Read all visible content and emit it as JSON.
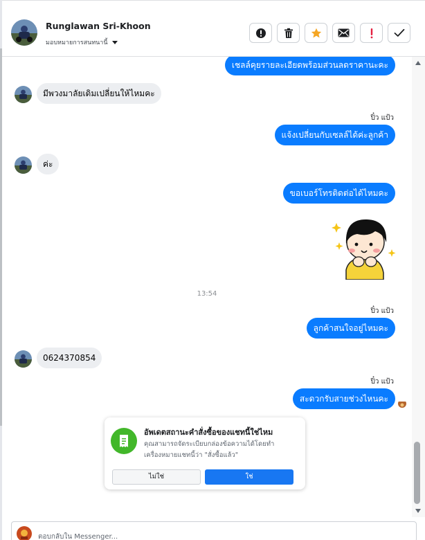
{
  "header": {
    "contact_name": "Runglawan Sri-Khoon",
    "assign_label": "มอบหมายการสนทนานี้",
    "actions": [
      {
        "name": "mark-spam-button",
        "icon": "alert-circle-icon"
      },
      {
        "name": "delete-button",
        "icon": "trash-icon"
      },
      {
        "name": "star-button",
        "icon": "star-icon"
      },
      {
        "name": "mark-unread-button",
        "icon": "envelope-icon"
      },
      {
        "name": "follow-up-button",
        "icon": "exclamation-icon"
      },
      {
        "name": "mark-done-button",
        "icon": "checkmark-icon"
      }
    ]
  },
  "thread": {
    "messages": [
      {
        "direction": "outgoing",
        "text": "เชลล์คุยรายละเอียดพร้อมส่วนลดราคานะคะ"
      },
      {
        "direction": "incoming",
        "text": "มีพวงมาลัยเดิมเปลี่ยนให้ไหมคะ"
      },
      {
        "direction": "outgoing",
        "sender": "ปิ๋ว แป้ว",
        "text": "แจ้งเปลี่ยนกับเซลล์ได้ค่ะลูกค้า"
      },
      {
        "direction": "incoming",
        "text": "ค่ะ"
      },
      {
        "direction": "outgoing",
        "text": "ขอเบอร์โทรติดต่อได้ไหมคะ"
      },
      {
        "direction": "outgoing",
        "type": "sticker",
        "sticker": "girl-sparkle-sticker"
      },
      {
        "type": "timestamp",
        "text": "13:54"
      },
      {
        "direction": "outgoing",
        "sender": "ปิ๋ว แป้ว",
        "text": "ลูกค้าสนใจอยู่ไหมคะ"
      },
      {
        "direction": "incoming",
        "text": "0624370854"
      },
      {
        "direction": "outgoing",
        "sender": "ปิ๋ว แป้ว",
        "text": "สะดวกรับสายช่วงไหนคะ"
      }
    ]
  },
  "order_prompt": {
    "icon": "order-receipt-icon",
    "title": "อัพเดตสถานะคำสั่งซื้อของแชทนี้ใช่ไหม",
    "body": "คุณสามารถจัดระเบียบกล่องข้อความได้โดยทำเครื่องหมายแชทนี้ว่า \"สั่งซื้อแล้ว\"",
    "no_label": "ไม่ใช่",
    "yes_label": "ใช่"
  },
  "composer": {
    "placeholder": "ตอบกลับใน Messenger..."
  },
  "colors": {
    "outgoing_bubble": "#0a7cff",
    "incoming_bubble": "#eceef1",
    "primary_button": "#1877f2",
    "order_icon_bg": "#42b72a",
    "star": "#f5a623",
    "follow_up": "#e41e3f"
  }
}
